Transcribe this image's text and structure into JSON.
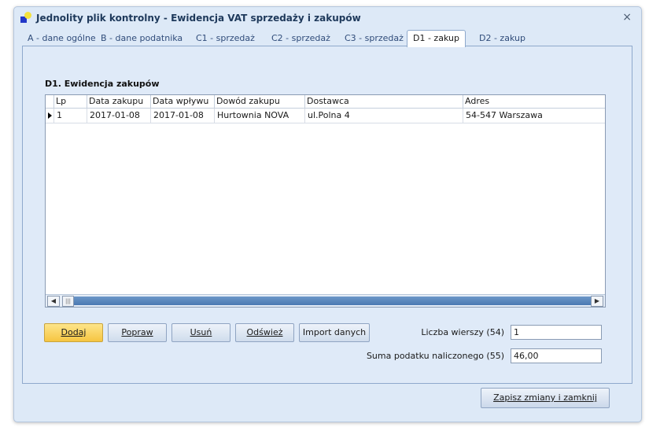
{
  "window": {
    "title": "Jednolity plik kontrolny - Ewidencja VAT sprzedaży i zakupów",
    "close_glyph": "×"
  },
  "tabs": [
    {
      "label": "A - dane ogólne"
    },
    {
      "label": "B   - dane podatnika"
    },
    {
      "label": "C1  - sprzedaż"
    },
    {
      "label": "C2  - sprzedaż"
    },
    {
      "label": "C3  - sprzedaż"
    },
    {
      "label": "D1  - zakup",
      "active": true
    },
    {
      "label": "D2  - zakup"
    }
  ],
  "section": {
    "title": "D1. Ewidencja zakupów"
  },
  "table": {
    "columns": [
      "Lp",
      "Data zakupu",
      "Data wpływu",
      "Dowód zakupu",
      "Dostawca",
      "Adres"
    ],
    "rows": [
      [
        "1",
        "2017-01-08",
        "2017-01-08",
        "Hurtownia NOVA",
        "ul.Polna 4",
        "54-547 Warszawa"
      ]
    ]
  },
  "buttons": {
    "add": "Dodaj",
    "edit": "Popraw",
    "delete": "Usuń",
    "refresh": "Odśwież",
    "import": "Import danych"
  },
  "summary": {
    "rows_label": "Liczba wierszy (54)",
    "rows_value": "1",
    "tax_label": "Suma podatku naliczonego (55)",
    "tax_value": "46,00"
  },
  "footer": {
    "save_close": "Zapisz zmiany i zamknij"
  },
  "icons": {
    "scroll_left": "left-arrow-icon",
    "scroll_right": "right-arrow-icon",
    "row_pointer": "row-pointer-icon",
    "app": "app-icon"
  },
  "colors": {
    "primary_button": "#f6c541",
    "scroll_track": "#4a79b2",
    "window_bg": "#dde9f7"
  }
}
